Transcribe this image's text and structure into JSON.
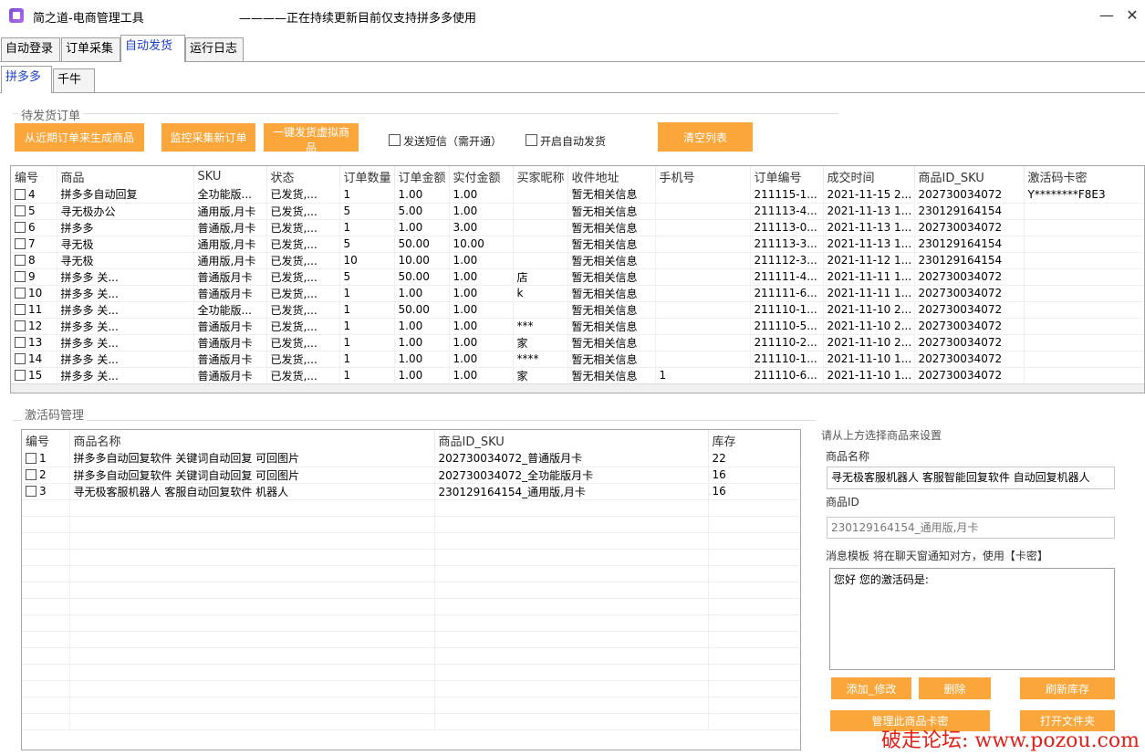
{
  "window": {
    "title": "简之道-电商管理工具",
    "subtitle": "————正在持续更新目前仅支持拼多多使用",
    "minimize": "—",
    "close": "✕"
  },
  "tabs": [
    "自动登录",
    "订单采集",
    "自动发货",
    "运行日志"
  ],
  "subtabs": [
    "拼多多",
    "千牛"
  ],
  "orders_section": {
    "label": "待发货订单",
    "buttons": [
      "从近期订单来生成商品",
      "监控采集新订单",
      "一键发货虚拟商品",
      "清空列表"
    ],
    "sms_checkbox": "发送短信（需开通）",
    "auto_checkbox": "开启自动发货",
    "columns": [
      "编号",
      "商品",
      "SKU",
      "状态",
      "订单数量",
      "订单金额",
      "实付金额",
      "买家昵称",
      "收件地址",
      "手机号",
      "订单编号",
      "成交时间",
      "商品ID_SKU",
      "激活码卡密"
    ],
    "rows": [
      [
        "4",
        "拼多多自动回复",
        "全功能版...",
        "已发货,...",
        "1",
        "1.00",
        "1.00",
        "",
        "暂无相关信息",
        "",
        "211115-1...",
        "2021-11-15 2...",
        "202730034072",
        "Y********F8E3"
      ],
      [
        "5",
        "寻无极办公",
        "通用版,月卡",
        "已发货,...",
        "5",
        "5.00",
        "1.00",
        "",
        "暂无相关信息",
        "",
        "211113-4...",
        "2021-11-13 1...",
        "230129164154",
        ""
      ],
      [
        "6",
        "拼多多",
        "普通版,月卡",
        "已发货,...",
        "1",
        "1.00",
        "3.00",
        "",
        "暂无相关信息",
        "",
        "211113-0...",
        "2021-11-13 1...",
        "202730034072",
        ""
      ],
      [
        "7",
        "寻无极",
        "通用版,月卡",
        "已发货,...",
        "5",
        "50.00",
        "10.00",
        "",
        "暂无相关信息",
        "",
        "211113-3...",
        "2021-11-13 1...",
        "230129164154",
        ""
      ],
      [
        "8",
        "寻无极",
        "通用版,月卡",
        "已发货,...",
        "10",
        "10.00",
        "1.00",
        "",
        "暂无相关信息",
        "",
        "211112-3...",
        "2021-11-12 1...",
        "230129164154",
        ""
      ],
      [
        "9",
        "拼多多 关...",
        "普通版月卡",
        "已发货,...",
        "5",
        "50.00",
        "1.00",
        "店",
        "暂无相关信息",
        "",
        "211111-4...",
        "2021-11-11 1...",
        "202730034072",
        ""
      ],
      [
        "10",
        "拼多多 关...",
        "普通版月卡",
        "已发货,...",
        "1",
        "1.00",
        "1.00",
        "k",
        "暂无相关信息",
        "",
        "211111-6...",
        "2021-11-11 1...",
        "202730034072",
        ""
      ],
      [
        "11",
        "拼多多 关...",
        "全功能版...",
        "已发货,...",
        "1",
        "50.00",
        "1.00",
        "",
        "暂无相关信息",
        "",
        "211110-1...",
        "2021-11-10 2...",
        "202730034072",
        ""
      ],
      [
        "12",
        "拼多多 关...",
        "普通版月卡",
        "已发货,...",
        "1",
        "1.00",
        "1.00",
        "***",
        "暂无相关信息",
        "",
        "211110-5...",
        "2021-11-10 2...",
        "202730034072",
        ""
      ],
      [
        "13",
        "拼多多 关...",
        "普通版月卡",
        "已发货,...",
        "1",
        "1.00",
        "1.00",
        "家",
        "暂无相关信息",
        "",
        "211110-2...",
        "2021-11-10 2...",
        "202730034072",
        ""
      ],
      [
        "14",
        "拼多多 关...",
        "普通版月卡",
        "已发货,...",
        "1",
        "1.00",
        "1.00",
        "****",
        "暂无相关信息",
        "",
        "211110-1...",
        "2021-11-10 1...",
        "202730034072",
        ""
      ],
      [
        "15",
        "拼多多 关...",
        "普通版月卡",
        "已发货,...",
        "1",
        "1.00",
        "1.00",
        "家",
        "暂无相关信息",
        "1",
        "211110-6...",
        "2021-11-10 1...",
        "202730034072",
        ""
      ]
    ]
  },
  "activation_section": {
    "label": "激活码管理",
    "columns": [
      "编号",
      "商品名称",
      "商品ID_SKU",
      "库存"
    ],
    "rows": [
      [
        "1",
        "拼多多自动回复软件 关键词自动回复 可回图片",
        "202730034072_普通版月卡",
        "22"
      ],
      [
        "2",
        "拼多多自动回复软件 关键词自动回复 可回图片",
        "202730034072_全功能版月卡",
        "16"
      ],
      [
        "3",
        "寻无极客服机器人 客服自动回复软件 机器人",
        "230129164154_通用版,月卡",
        "16"
      ]
    ]
  },
  "settings_panel": {
    "label": "请从上方选择商品来设置",
    "name_label": "商品名称",
    "name_value": "寻无极客服机器人 客服智能回复软件 自动回复机器人",
    "id_label": "商品ID",
    "id_placeholder": "230129164154_通用版,月卡",
    "message_label": "消息模板 将在聊天窗通知对方，使用【卡密】",
    "message_value": "您好 您的激活码是:",
    "buttons": [
      "添加_修改",
      "删除",
      "刷新库存",
      "管理此商品卡密",
      "打开文件夹"
    ]
  },
  "watermark": "破走论坛: www.pozou.com"
}
